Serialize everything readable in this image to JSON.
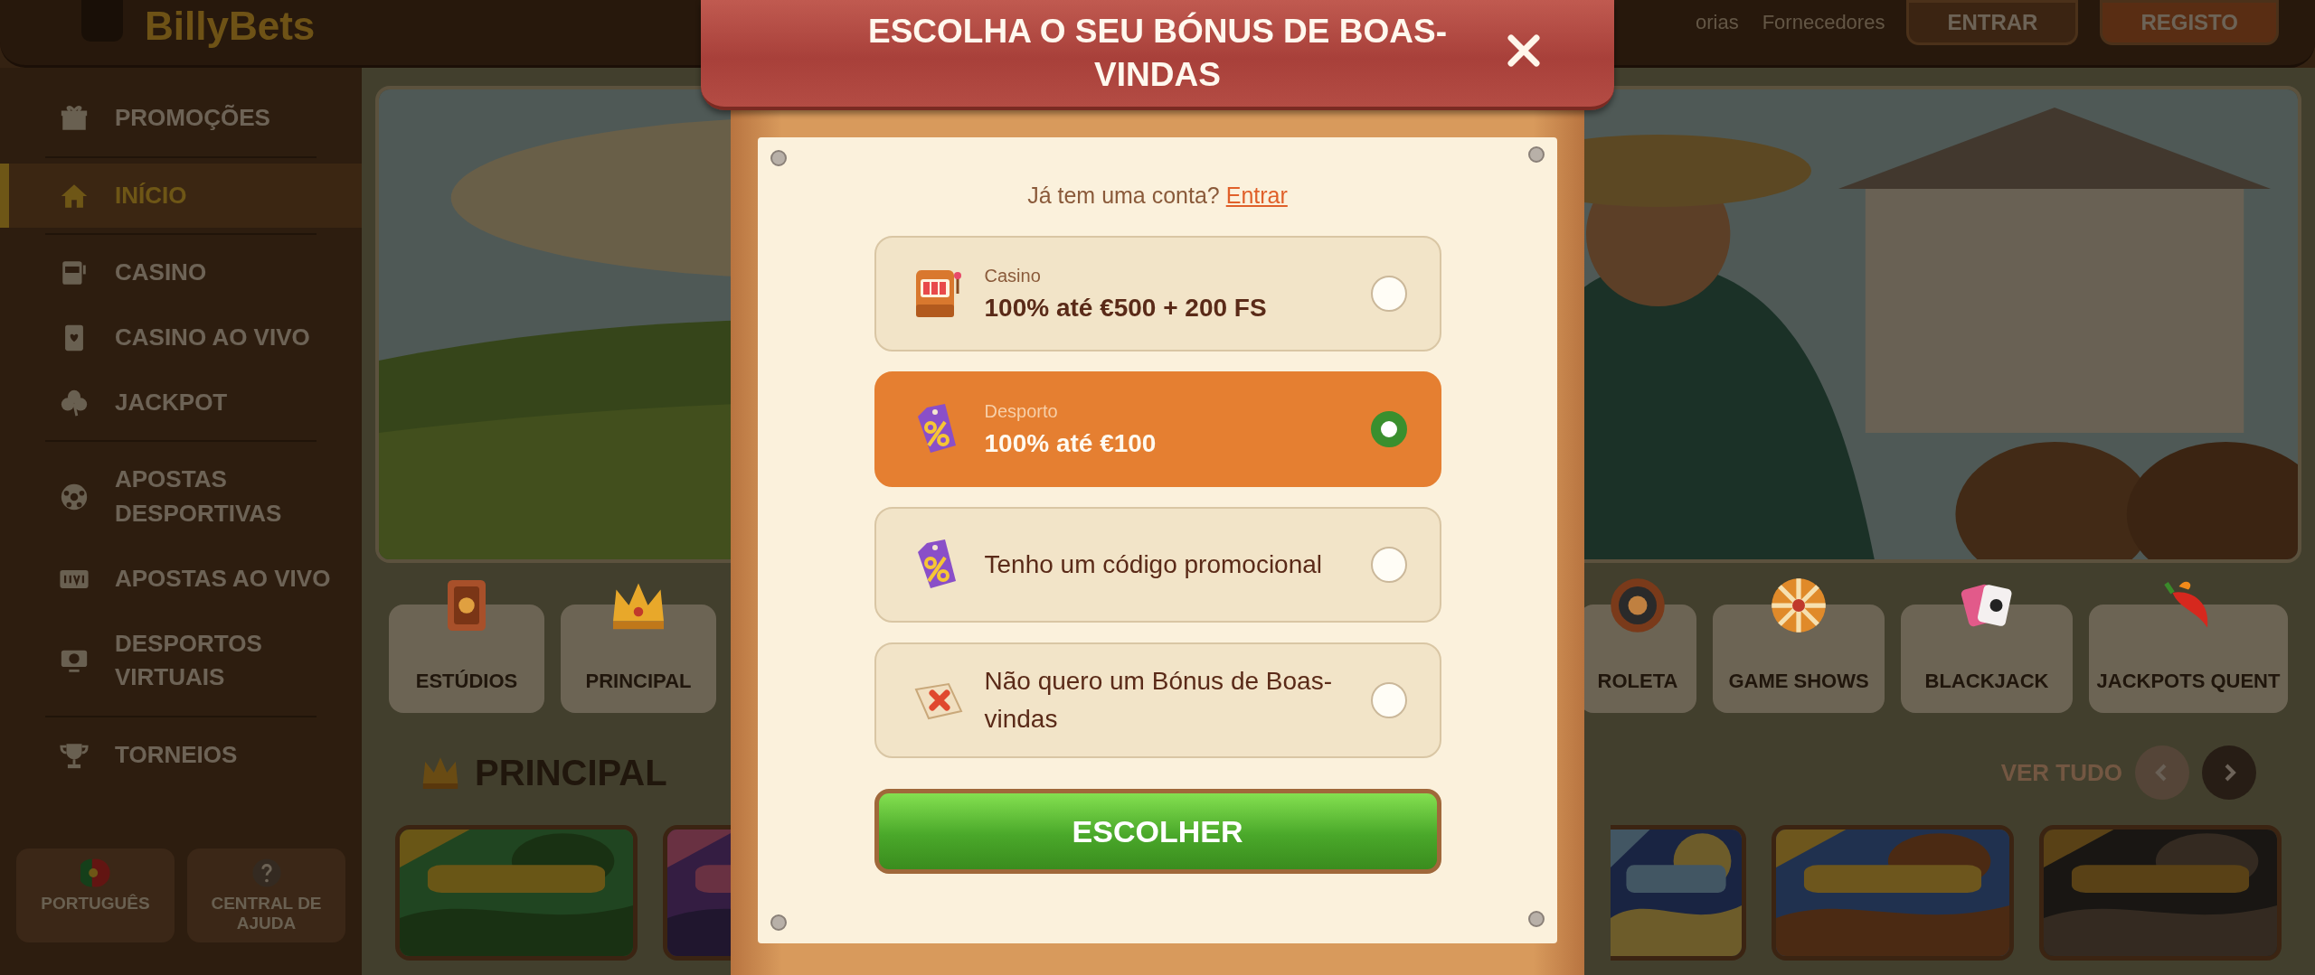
{
  "header": {
    "logo": "BillyBets",
    "nav_links": [
      "orias",
      "Fornecedores"
    ],
    "buttons": [
      "ENTRAR",
      "REGISTO"
    ]
  },
  "sidebar": {
    "groups": [
      [
        {
          "label": "PROMOÇÕES",
          "selected": false
        }
      ],
      [
        {
          "label": "INÍCIO",
          "selected": true
        }
      ],
      [
        {
          "label": "CASINO",
          "selected": false
        },
        {
          "label": "CASINO AO VIVO",
          "selected": false
        },
        {
          "label": "JACKPOT",
          "selected": false
        }
      ],
      [
        {
          "label": "APOSTAS DESPORTIVAS",
          "selected": false
        },
        {
          "label": "APOSTAS AO VIVO",
          "selected": false
        },
        {
          "label": "DESPORTOS VIRTUAIS",
          "selected": false
        }
      ],
      [
        {
          "label": "TORNEIOS",
          "selected": false
        }
      ]
    ],
    "footer_buttons": [
      "PORTUGUÊS",
      "CENTRAL DE AJUDA"
    ]
  },
  "banner": {
    "kind": "picture"
  },
  "categories_left": [
    "ESTÚDIOS",
    "PRINCIPAL"
  ],
  "categories_right": [
    "ROLETA",
    "GAME SHOWS",
    "BLACKJACK",
    "JACKPOTS QUENT"
  ],
  "section": {
    "title": "PRINCIPAL",
    "link": "VER TUDO"
  },
  "games_left": [
    {
      "kind": "picture"
    },
    {
      "kind": "picture"
    }
  ],
  "games_right": [
    {
      "kind": "picture"
    },
    {
      "kind": "picture"
    },
    {
      "kind": "picture"
    }
  ],
  "modal": {
    "title": "ESCOLHA O SEU BÓNUS DE BOAS-VINDAS",
    "login_prompt": "Já tem uma conta?",
    "login_link": "Entrar",
    "options": [
      {
        "kind": "bonus",
        "category": "Casino",
        "offer": "100% até €500 + 200 FS",
        "selected": false
      },
      {
        "kind": "bonus",
        "category": "Desporto",
        "offer": "100% até €100",
        "selected": true
      },
      {
        "kind": "plain",
        "label": "Tenho um código promocional",
        "selected": false
      },
      {
        "kind": "plain",
        "label": "Não quero um Bónus de Boas-vindas",
        "selected": false
      }
    ],
    "submit": "ESCOLHER"
  }
}
